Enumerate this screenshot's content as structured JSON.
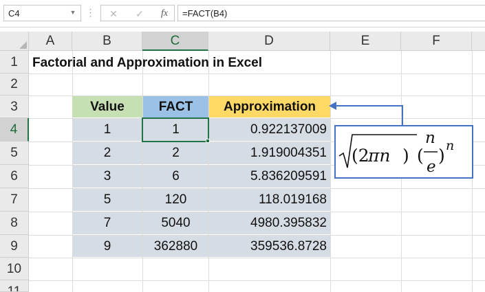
{
  "formula_bar": {
    "name_box": "C4",
    "cancel_icon": "✕",
    "enter_icon": "✓",
    "fx_label": "fx",
    "formula": "=FACT(B4)"
  },
  "columns": [
    "A",
    "B",
    "C",
    "D",
    "E",
    "F"
  ],
  "rows": [
    "1",
    "2",
    "3",
    "4",
    "5",
    "6",
    "7",
    "8",
    "9",
    "10",
    "11"
  ],
  "active_cell": "C4",
  "sheet": {
    "title": "Factorial and Approximation in Excel",
    "table": {
      "headers": [
        "Value",
        "FACT",
        "Approximation"
      ],
      "rows": [
        [
          "1",
          "1",
          "0.922137009"
        ],
        [
          "2",
          "2",
          "1.919004351"
        ],
        [
          "3",
          "6",
          "5.836209591"
        ],
        [
          "5",
          "120",
          "118.019168"
        ],
        [
          "7",
          "5040",
          "4980.395832"
        ],
        [
          "9",
          "362880",
          "359536.8728"
        ]
      ]
    },
    "header_colors": {
      "value": "#c6e0b4",
      "fact": "#9bc2e6",
      "approximation": "#ffd966"
    },
    "table_fill": "#d6dce4"
  },
  "annotation": {
    "formula_text": "√(2πn)(n/e)^n",
    "border_color": "#4472c4",
    "arrow_color": "#4472c4"
  }
}
